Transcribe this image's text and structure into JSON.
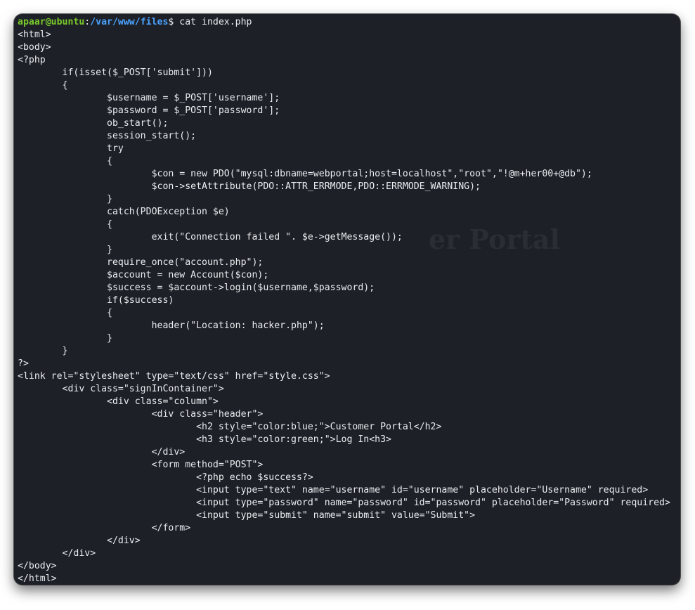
{
  "terminal": {
    "prompt": {
      "user_host": "apaar@ubuntu",
      "separator": ":",
      "path": "/var/www/files",
      "symbol": "$ ",
      "command": "cat index.php"
    },
    "background_ghost_text": "er Portal",
    "colors": {
      "background": "#1d2026",
      "text": "#e9ecef",
      "prompt_user": "#79c82a",
      "prompt_path": "#4aa3ff"
    },
    "output_lines": [
      "<html>",
      "<body>",
      "<?php",
      "\tif(isset($_POST['submit']))",
      "\t{",
      "\t\t$username = $_POST['username'];",
      "\t\t$password = $_POST['password'];",
      "\t\tob_start();",
      "\t\tsession_start();",
      "\t\ttry",
      "\t\t{",
      "\t\t\t$con = new PDO(\"mysql:dbname=webportal;host=localhost\",\"root\",\"!@m+her00+@db\");",
      "\t\t\t$con->setAttribute(PDO::ATTR_ERRMODE,PDO::ERRMODE_WARNING);",
      "\t\t}",
      "\t\tcatch(PDOException $e)",
      "\t\t{",
      "\t\t\texit(\"Connection failed \". $e->getMessage());",
      "\t\t}",
      "\t\trequire_once(\"account.php\");",
      "\t\t$account = new Account($con);",
      "\t\t$success = $account->login($username,$password);",
      "\t\tif($success)",
      "\t\t{",
      "\t\t\theader(\"Location: hacker.php\");",
      "\t\t}",
      "\t}",
      "?>",
      "<link rel=\"stylesheet\" type=\"text/css\" href=\"style.css\">",
      "\t<div class=\"signInContainer\">",
      "\t\t<div class=\"column\">",
      "\t\t\t<div class=\"header\">",
      "\t\t\t\t<h2 style=\"color:blue;\">Customer Portal</h2>",
      "\t\t\t\t<h3 style=\"color:green;\">Log In<h3>",
      "\t\t\t</div>",
      "\t\t\t<form method=\"POST\">",
      "\t\t\t\t<?php echo $success?>",
      "\t\t\t\t<input type=\"text\" name=\"username\" id=\"username\" placeholder=\"Username\" required>",
      "\t\t\t\t<input type=\"password\" name=\"password\" id=\"password\" placeholder=\"Password\" required>",
      "\t\t\t\t<input type=\"submit\" name=\"submit\" value=\"Submit\">",
      "\t\t\t</form>",
      "\t\t</div>",
      "\t</div>",
      "</body>",
      "</html>"
    ]
  }
}
